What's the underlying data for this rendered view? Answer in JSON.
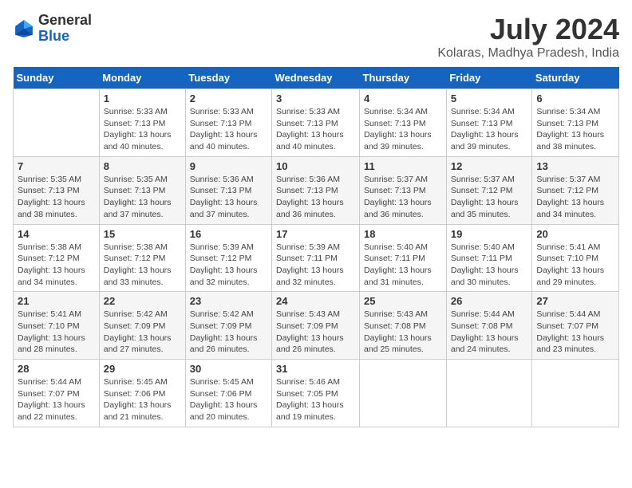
{
  "header": {
    "logo": {
      "line1": "General",
      "line2": "Blue"
    },
    "title": "July 2024",
    "subtitle": "Kolaras, Madhya Pradesh, India"
  },
  "columns": [
    "Sunday",
    "Monday",
    "Tuesday",
    "Wednesday",
    "Thursday",
    "Friday",
    "Saturday"
  ],
  "weeks": [
    [
      {
        "day": "",
        "sunrise": "",
        "sunset": "",
        "daylight": ""
      },
      {
        "day": "1",
        "sunrise": "Sunrise: 5:33 AM",
        "sunset": "Sunset: 7:13 PM",
        "daylight": "Daylight: 13 hours and 40 minutes."
      },
      {
        "day": "2",
        "sunrise": "Sunrise: 5:33 AM",
        "sunset": "Sunset: 7:13 PM",
        "daylight": "Daylight: 13 hours and 40 minutes."
      },
      {
        "day": "3",
        "sunrise": "Sunrise: 5:33 AM",
        "sunset": "Sunset: 7:13 PM",
        "daylight": "Daylight: 13 hours and 40 minutes."
      },
      {
        "day": "4",
        "sunrise": "Sunrise: 5:34 AM",
        "sunset": "Sunset: 7:13 PM",
        "daylight": "Daylight: 13 hours and 39 minutes."
      },
      {
        "day": "5",
        "sunrise": "Sunrise: 5:34 AM",
        "sunset": "Sunset: 7:13 PM",
        "daylight": "Daylight: 13 hours and 39 minutes."
      },
      {
        "day": "6",
        "sunrise": "Sunrise: 5:34 AM",
        "sunset": "Sunset: 7:13 PM",
        "daylight": "Daylight: 13 hours and 38 minutes."
      }
    ],
    [
      {
        "day": "7",
        "sunrise": "Sunrise: 5:35 AM",
        "sunset": "Sunset: 7:13 PM",
        "daylight": "Daylight: 13 hours and 38 minutes."
      },
      {
        "day": "8",
        "sunrise": "Sunrise: 5:35 AM",
        "sunset": "Sunset: 7:13 PM",
        "daylight": "Daylight: 13 hours and 37 minutes."
      },
      {
        "day": "9",
        "sunrise": "Sunrise: 5:36 AM",
        "sunset": "Sunset: 7:13 PM",
        "daylight": "Daylight: 13 hours and 37 minutes."
      },
      {
        "day": "10",
        "sunrise": "Sunrise: 5:36 AM",
        "sunset": "Sunset: 7:13 PM",
        "daylight": "Daylight: 13 hours and 36 minutes."
      },
      {
        "day": "11",
        "sunrise": "Sunrise: 5:37 AM",
        "sunset": "Sunset: 7:13 PM",
        "daylight": "Daylight: 13 hours and 36 minutes."
      },
      {
        "day": "12",
        "sunrise": "Sunrise: 5:37 AM",
        "sunset": "Sunset: 7:12 PM",
        "daylight": "Daylight: 13 hours and 35 minutes."
      },
      {
        "day": "13",
        "sunrise": "Sunrise: 5:37 AM",
        "sunset": "Sunset: 7:12 PM",
        "daylight": "Daylight: 13 hours and 34 minutes."
      }
    ],
    [
      {
        "day": "14",
        "sunrise": "Sunrise: 5:38 AM",
        "sunset": "Sunset: 7:12 PM",
        "daylight": "Daylight: 13 hours and 34 minutes."
      },
      {
        "day": "15",
        "sunrise": "Sunrise: 5:38 AM",
        "sunset": "Sunset: 7:12 PM",
        "daylight": "Daylight: 13 hours and 33 minutes."
      },
      {
        "day": "16",
        "sunrise": "Sunrise: 5:39 AM",
        "sunset": "Sunset: 7:12 PM",
        "daylight": "Daylight: 13 hours and 32 minutes."
      },
      {
        "day": "17",
        "sunrise": "Sunrise: 5:39 AM",
        "sunset": "Sunset: 7:11 PM",
        "daylight": "Daylight: 13 hours and 32 minutes."
      },
      {
        "day": "18",
        "sunrise": "Sunrise: 5:40 AM",
        "sunset": "Sunset: 7:11 PM",
        "daylight": "Daylight: 13 hours and 31 minutes."
      },
      {
        "day": "19",
        "sunrise": "Sunrise: 5:40 AM",
        "sunset": "Sunset: 7:11 PM",
        "daylight": "Daylight: 13 hours and 30 minutes."
      },
      {
        "day": "20",
        "sunrise": "Sunrise: 5:41 AM",
        "sunset": "Sunset: 7:10 PM",
        "daylight": "Daylight: 13 hours and 29 minutes."
      }
    ],
    [
      {
        "day": "21",
        "sunrise": "Sunrise: 5:41 AM",
        "sunset": "Sunset: 7:10 PM",
        "daylight": "Daylight: 13 hours and 28 minutes."
      },
      {
        "day": "22",
        "sunrise": "Sunrise: 5:42 AM",
        "sunset": "Sunset: 7:09 PM",
        "daylight": "Daylight: 13 hours and 27 minutes."
      },
      {
        "day": "23",
        "sunrise": "Sunrise: 5:42 AM",
        "sunset": "Sunset: 7:09 PM",
        "daylight": "Daylight: 13 hours and 26 minutes."
      },
      {
        "day": "24",
        "sunrise": "Sunrise: 5:43 AM",
        "sunset": "Sunset: 7:09 PM",
        "daylight": "Daylight: 13 hours and 26 minutes."
      },
      {
        "day": "25",
        "sunrise": "Sunrise: 5:43 AM",
        "sunset": "Sunset: 7:08 PM",
        "daylight": "Daylight: 13 hours and 25 minutes."
      },
      {
        "day": "26",
        "sunrise": "Sunrise: 5:44 AM",
        "sunset": "Sunset: 7:08 PM",
        "daylight": "Daylight: 13 hours and 24 minutes."
      },
      {
        "day": "27",
        "sunrise": "Sunrise: 5:44 AM",
        "sunset": "Sunset: 7:07 PM",
        "daylight": "Daylight: 13 hours and 23 minutes."
      }
    ],
    [
      {
        "day": "28",
        "sunrise": "Sunrise: 5:44 AM",
        "sunset": "Sunset: 7:07 PM",
        "daylight": "Daylight: 13 hours and 22 minutes."
      },
      {
        "day": "29",
        "sunrise": "Sunrise: 5:45 AM",
        "sunset": "Sunset: 7:06 PM",
        "daylight": "Daylight: 13 hours and 21 minutes."
      },
      {
        "day": "30",
        "sunrise": "Sunrise: 5:45 AM",
        "sunset": "Sunset: 7:06 PM",
        "daylight": "Daylight: 13 hours and 20 minutes."
      },
      {
        "day": "31",
        "sunrise": "Sunrise: 5:46 AM",
        "sunset": "Sunset: 7:05 PM",
        "daylight": "Daylight: 13 hours and 19 minutes."
      },
      {
        "day": "",
        "sunrise": "",
        "sunset": "",
        "daylight": ""
      },
      {
        "day": "",
        "sunrise": "",
        "sunset": "",
        "daylight": ""
      },
      {
        "day": "",
        "sunrise": "",
        "sunset": "",
        "daylight": ""
      }
    ]
  ]
}
